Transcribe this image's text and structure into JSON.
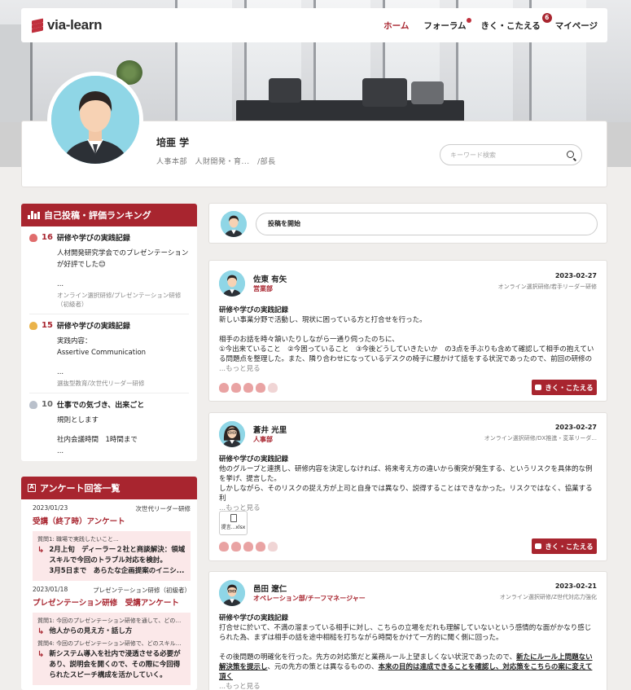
{
  "brand": {
    "name": "via-learn",
    "accent": "#a8252f"
  },
  "nav": {
    "items": [
      {
        "label": "ホーム",
        "active": true
      },
      {
        "label": "フォーラム",
        "dot": true
      },
      {
        "label": "きく・こたえる",
        "badge": "6"
      },
      {
        "label": "マイページ"
      }
    ]
  },
  "profile": {
    "name": "培亜 学",
    "dept": "人事本部　人財開発・育...　/部長",
    "search_placeholder": "キーワード検索"
  },
  "ranking": {
    "title": "自己投稿・評価ランキング",
    "items": [
      {
        "count": "16",
        "title": "研修や学びの実践記録",
        "body1": "人材開発研究学会でのプレゼンテーション",
        "body2": "が好評でした😊",
        "ellipsis": "...",
        "tag": "オンライン選択研修/プレゼンテーション研修（初級者）"
      },
      {
        "count": "15",
        "title": "研修や学びの実践記録",
        "body1": "実践内容：",
        "body2": "Assertive Communication",
        "ellipsis": "...",
        "tag": "選抜型教育/次世代リーダー研修"
      },
      {
        "count": "10",
        "title": "仕事での気づき、出来ごと",
        "body1": "規則とします",
        "body2": "社内会議時間　1時間まで",
        "ellipsis": "..."
      }
    ]
  },
  "survey": {
    "title": "アンケート回答一覧",
    "items": [
      {
        "date": "2023/01/23",
        "program": "次世代リーダー研修",
        "title": "受講（終了時）アンケート",
        "qa": [
          {
            "q": "質問1: 職場で実践したいこと...",
            "a": [
              "2月上旬　ディーラー２社と商談解決：領域",
              "スキルで今回のトラブル対応を検討。",
              "3月5日まで　あらたな企画提案のイニシ..."
            ]
          }
        ]
      },
      {
        "date": "2023/01/18",
        "program": "プレゼンテーション研修（初級者）",
        "title": "プレゼンテーション研修　受講アンケート",
        "qa": [
          {
            "q": "質問1: 今回のプレゼンテーション研修を通して、どのよ...",
            "a": [
              "他人からの見え方・話し方"
            ]
          },
          {
            "q": "質問4: 今回のプレゼンテーション研修で、どのスキルを1...",
            "a": [
              "新システム導入を社内で浸透させる必要が",
              "あり、説明会を開くので、その際に今回得",
              "られたスピーチ構成を活かしていく。"
            ]
          }
        ]
      }
    ]
  },
  "composer": {
    "label": "投稿を開始"
  },
  "posts": [
    {
      "name": "佐東 有矢",
      "dept": "営業部",
      "date": "2023-02-27",
      "tag": "オンライン選択研修/若手リーダー研修",
      "title": "研修や学びの実践記録",
      "lines": [
        "新しい事業分野で活動し、現状に困っている方と打合せを行った。",
        "",
        "相手のお話を時々頷いたりしながら一通り伺ったのちに、",
        "①今出来ていること　②今困っていること　③今後どうしていきたいか　の3点を手ぶりも含めて確認して相手の抱えている問題点を整理した。また、隣り合わせになっているデスクの椅子に腰かけて話をする状況であったので、前回の研修の"
      ],
      "more": "...もっと見る",
      "button": "きく・こたえる"
    },
    {
      "name": "蒼井 光里",
      "dept": "人事部",
      "date": "2023-02-27",
      "tag": "オンライン選択研修/DX推進・変革リーダ...",
      "title": "研修や学びの実践記録",
      "lines": [
        "他のグループと連携し、研修内容を決定しなければ、将来考え方の違いから衝突が発生する、というリスクを具体的な例を挙げ、提言した。",
        "しかしながら、そのリスクの捉え方が上司と自身では異なり、説得することはできなかった。リスクではなく、協業する利"
      ],
      "more": "...もっと見る",
      "attachment": "提言...xlsx",
      "button": "きく・こたえる"
    },
    {
      "name": "邑田 遼仁",
      "dept": "オペレーション部/チーフマネージャー",
      "date": "2023-02-21",
      "tag": "オンライン選択研修/Z世代対応力強化",
      "title": "研修や学びの実践記録",
      "line1": "打合せに於いて、不満の溜まっている相手に対し、こちらの立場をだれも理解していないという感情的な面がかなり感じられた為、まずは相手の話を途中相槌を打ちながら時間をかけて一方的に聞く側に回った。",
      "line2a": "その後問題の明確化を行った。先方の対応策だと業務ルール上望ましくない状況であったので、",
      "line2b": "新たにルール上問題ない解決策を提示し",
      "line2c": "、元の先方の策とは異なるものの、",
      "line2d": "本来の目的は達成できることを確認し、対応策をこちらの案に変えて頂く",
      "more": "...もっと見る"
    }
  ]
}
